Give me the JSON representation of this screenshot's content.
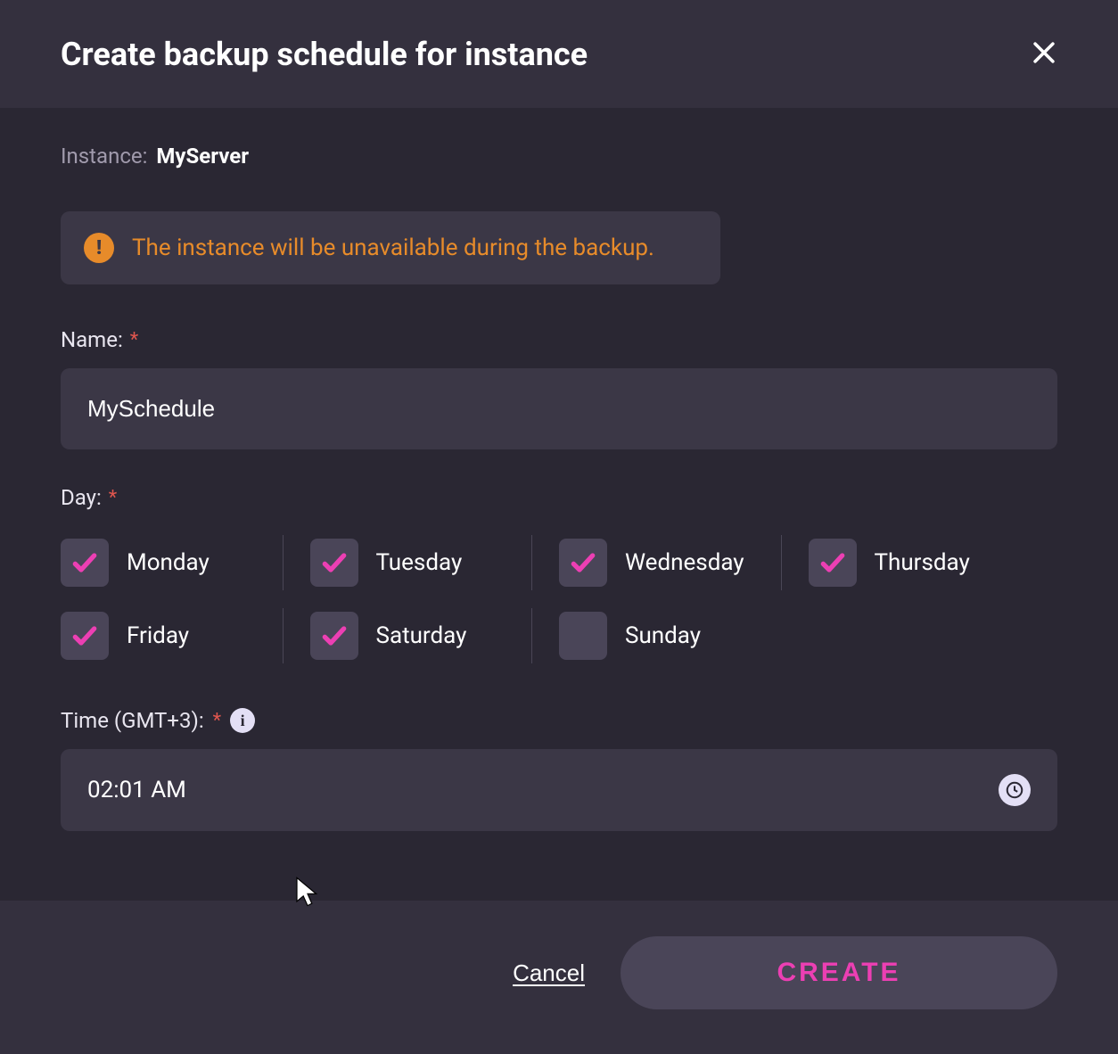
{
  "header": {
    "title": "Create backup schedule for instance"
  },
  "instance": {
    "label": "Instance:",
    "name": "MyServer"
  },
  "warning": {
    "text": "The instance will be unavailable during the backup."
  },
  "nameField": {
    "label": "Name:",
    "value": "MySchedule"
  },
  "dayField": {
    "label": "Day:",
    "days": [
      {
        "label": "Monday",
        "checked": true
      },
      {
        "label": "Tuesday",
        "checked": true
      },
      {
        "label": "Wednesday",
        "checked": true
      },
      {
        "label": "Thursday",
        "checked": true
      },
      {
        "label": "Friday",
        "checked": true
      },
      {
        "label": "Saturday",
        "checked": true
      },
      {
        "label": "Sunday",
        "checked": false
      }
    ]
  },
  "timeField": {
    "label": "Time (GMT+3):",
    "value": "02:01 AM"
  },
  "footer": {
    "cancel": "Cancel",
    "create": "CREATE"
  },
  "colors": {
    "accent": "#ec3fb3",
    "warning": "#e78b2a"
  }
}
